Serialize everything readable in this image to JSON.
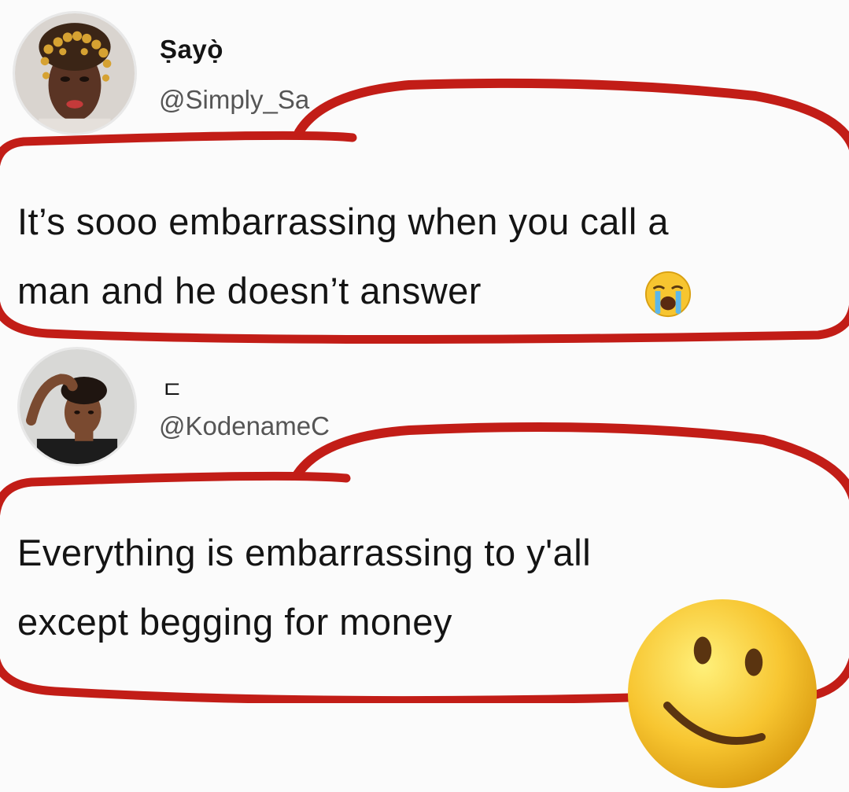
{
  "tweets": [
    {
      "display_name": "Ṣayọ̀",
      "handle": "@Simply_Sa",
      "text_line_1": "It’s sooo embarrassing when you call a",
      "text_line_2": "man and he doesn’t answer",
      "emoji": "loudly-crying-face-icon"
    },
    {
      "display_name": "ㄷ",
      "handle": "@KodenameC",
      "text_line_1": "Everything is embarrassing to y'all",
      "text_line_2": "except begging for money",
      "emoji": "upside-down-face-icon"
    }
  ],
  "colors": {
    "background": "#fbfbfb",
    "text": "#141414",
    "handle": "#555555",
    "marker_red": "#c21d17",
    "emoji_yellow": "#f7c530"
  }
}
